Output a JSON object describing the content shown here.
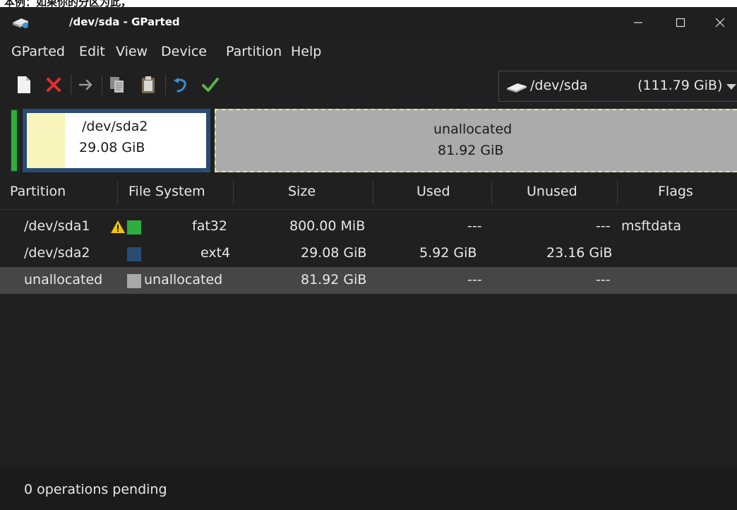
{
  "caption": "本例：如果你的分区为此，",
  "window": {
    "title": "/dev/sda - GParted"
  },
  "menu": [
    "GParted",
    "Edit",
    "View",
    "Device",
    "Partition",
    "Help"
  ],
  "toolbar": {
    "buttons": [
      {
        "name": "new",
        "icon": "new-partition-icon"
      },
      {
        "name": "delete",
        "icon": "delete-icon",
        "color": "#e03030"
      },
      {
        "name": "resize",
        "icon": "resize-move-icon"
      },
      {
        "name": "copy",
        "icon": "copy-icon"
      },
      {
        "name": "paste",
        "icon": "paste-icon"
      },
      {
        "name": "undo",
        "icon": "undo-icon",
        "color": "#3a8fd8"
      },
      {
        "name": "apply",
        "icon": "apply-icon",
        "color": "#5ab04a"
      }
    ]
  },
  "device": {
    "name": "/dev/sda",
    "size": "(111.79 GiB)"
  },
  "visual": {
    "sda2": {
      "name": "/dev/sda2",
      "size": "29.08 GiB"
    },
    "unallocated": {
      "name": "unallocated",
      "size": "81.92 GiB"
    }
  },
  "columns": [
    "Partition",
    "File System",
    "Size",
    "Used",
    "Unused",
    "Flags"
  ],
  "rows": [
    {
      "partition": "/dev/sda1",
      "fs": "fat32",
      "fs_color": "#2eae3e",
      "size": "800.00 MiB",
      "used": "---",
      "unused": "---",
      "flags": "msftdata",
      "warning": true
    },
    {
      "partition": "/dev/sda2",
      "fs": "ext4",
      "fs_color": "#2a4b73",
      "size": "29.08 GiB",
      "used": "5.92 GiB",
      "unused": "23.16 GiB",
      "flags": ""
    },
    {
      "partition": "unallocated",
      "fs": "unallocated",
      "fs_color": "#a8a8a8",
      "size": "81.92 GiB",
      "used": "---",
      "unused": "---",
      "flags": "",
      "selected": true
    }
  ],
  "status": "0 operations pending"
}
